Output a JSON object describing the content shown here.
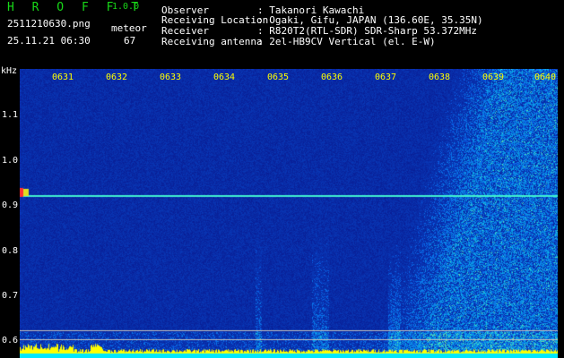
{
  "header": {
    "title": "H R O F F T",
    "version": "1.0.0",
    "filename": "2511210630.png",
    "datetime": "25.11.21 06:30",
    "meteor_label": "meteor",
    "meteor_count": "67"
  },
  "info": [
    {
      "label": "Observer",
      "value": ": Takanori Kawachi"
    },
    {
      "label": "Receiving Location",
      "value": ": Ogaki, Gifu, JAPAN (136.60E, 35.35N)"
    },
    {
      "label": "Receiver",
      "value": ": R820T2(RTL-SDR) SDR-Sharp 53.372MHz"
    },
    {
      "label": "Receiving antenna",
      "value": ": 2el-HB9CV Vertical (el. E-W)"
    }
  ],
  "axis": {
    "unit": "kHz",
    "y_labels": [
      "1.1",
      "1.0",
      "0.9",
      "0.8",
      "0.7",
      "0.6"
    ],
    "x_ticks": [
      "0631",
      "0632",
      "0633",
      "0634",
      "0635",
      "0636",
      "0637",
      "0638",
      "0639",
      "0640"
    ]
  },
  "colors": {
    "background": "#000000",
    "spectrogram_bg": "#08208f",
    "header_green": "#18d818",
    "label_yellow": "#ffff00",
    "carrier_cyan": "#40f0d0",
    "signal_bar": "#ffff00",
    "noise_floor": "#00e8ff"
  }
}
